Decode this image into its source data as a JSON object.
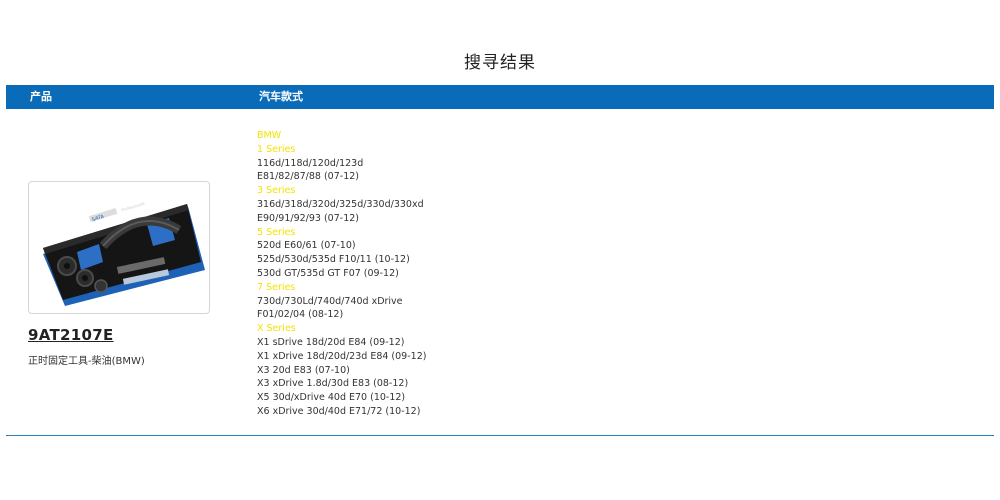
{
  "page": {
    "title": "搜寻结果"
  },
  "table_header": {
    "product_label": "产品",
    "models_label": "汽车款式"
  },
  "product": {
    "code": "9AT2107E",
    "description": "正时固定工具-柴油(BMW)",
    "image_brand": "SATA",
    "image_caption": "Professional"
  },
  "colors": {
    "header_blue": "#0a6bb8",
    "heading_yellow": "#f3e300",
    "rule_blue": "#2a80c0"
  },
  "models": [
    {
      "text": "BMW",
      "heading": true
    },
    {
      "text": "1 Series",
      "heading": true
    },
    {
      "text": "116d/118d/120d/123d",
      "heading": false
    },
    {
      "text": "E81/82/87/88 (07-12)",
      "heading": false
    },
    {
      "text": "3 Series",
      "heading": true
    },
    {
      "text": "316d/318d/320d/325d/330d/330xd",
      "heading": false
    },
    {
      "text": "E90/91/92/93 (07-12)",
      "heading": false
    },
    {
      "text": "5 Series",
      "heading": true
    },
    {
      "text": "520d E60/61 (07-10)",
      "heading": false
    },
    {
      "text": "525d/530d/535d F10/11 (10-12)",
      "heading": false
    },
    {
      "text": "530d GT/535d GT F07 (09-12)",
      "heading": false
    },
    {
      "text": "7 Series",
      "heading": true
    },
    {
      "text": "730d/730Ld/740d/740d xDrive",
      "heading": false
    },
    {
      "text": "F01/02/04 (08-12)",
      "heading": false
    },
    {
      "text": "X Series",
      "heading": true
    },
    {
      "text": "X1 sDrive 18d/20d E84 (09-12)",
      "heading": false
    },
    {
      "text": "X1 xDrive 18d/20d/23d E84 (09-12)",
      "heading": false
    },
    {
      "text": "X3 20d E83 (07-10)",
      "heading": false
    },
    {
      "text": "X3 xDrive 1.8d/30d E83 (08-12)",
      "heading": false
    },
    {
      "text": "X5 30d/xDrive 40d E70 (10-12)",
      "heading": false
    },
    {
      "text": "X6 xDrive 30d/40d E71/72 (10-12)",
      "heading": false
    }
  ]
}
